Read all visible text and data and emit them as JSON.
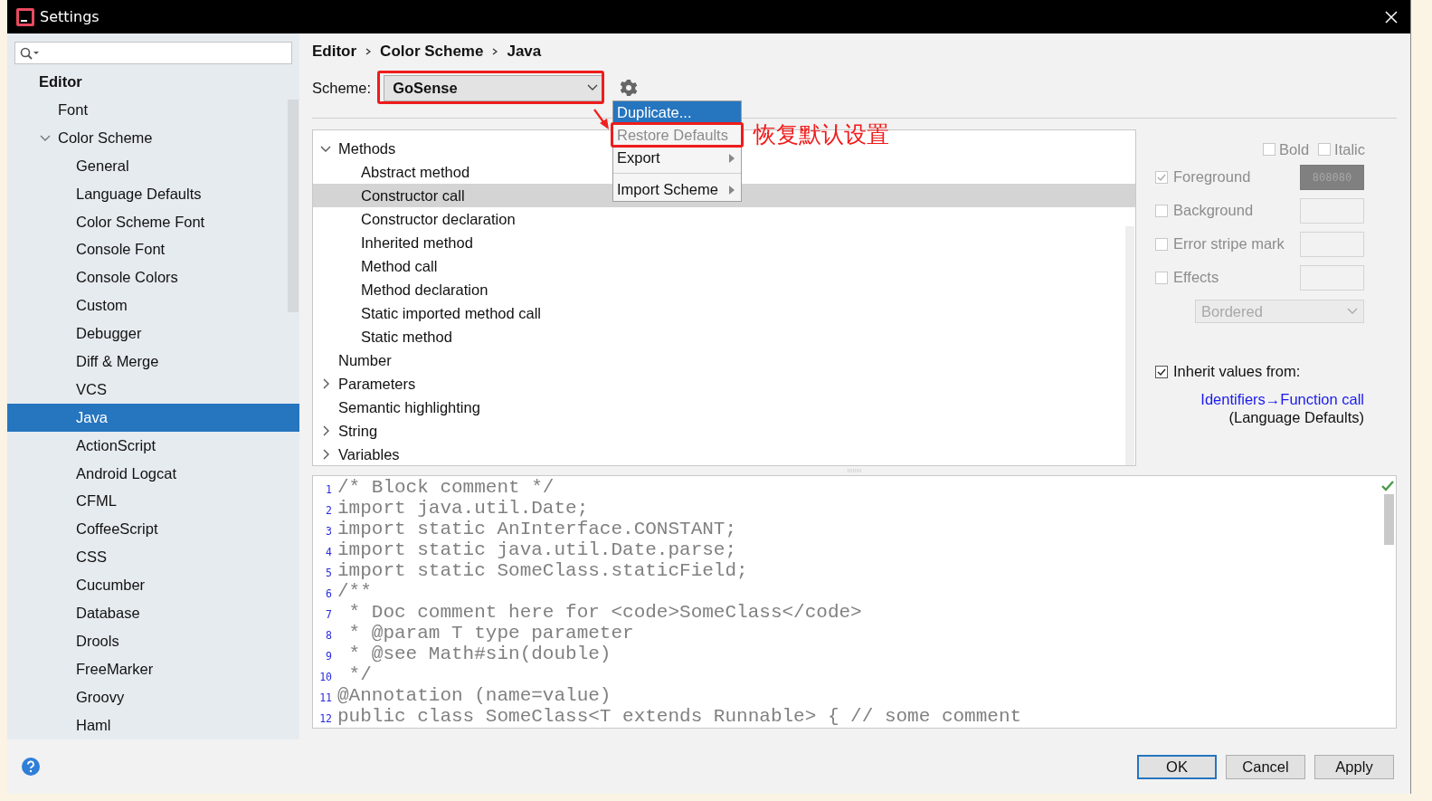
{
  "window": {
    "title": "Settings"
  },
  "sidebar": {
    "section": "Editor",
    "items": [
      {
        "label": "Font",
        "selected": false
      },
      {
        "label": "Color Scheme",
        "selected": false,
        "expanded": true,
        "children": [
          {
            "label": "General",
            "selected": false
          },
          {
            "label": "Language Defaults",
            "selected": false
          },
          {
            "label": "Color Scheme Font",
            "selected": false
          },
          {
            "label": "Console Font",
            "selected": false
          },
          {
            "label": "Console Colors",
            "selected": false
          },
          {
            "label": "Custom",
            "selected": false
          },
          {
            "label": "Debugger",
            "selected": false
          },
          {
            "label": "Diff & Merge",
            "selected": false
          },
          {
            "label": "VCS",
            "selected": false
          },
          {
            "label": "Java",
            "selected": true
          },
          {
            "label": "ActionScript",
            "selected": false
          },
          {
            "label": "Android Logcat",
            "selected": false
          },
          {
            "label": "CFML",
            "selected": false
          },
          {
            "label": "CoffeeScript",
            "selected": false
          },
          {
            "label": "CSS",
            "selected": false
          },
          {
            "label": "Cucumber",
            "selected": false
          },
          {
            "label": "Database",
            "selected": false
          },
          {
            "label": "Drools",
            "selected": false
          },
          {
            "label": "FreeMarker",
            "selected": false
          },
          {
            "label": "Groovy",
            "selected": false
          },
          {
            "label": "Haml",
            "selected": false
          }
        ]
      }
    ]
  },
  "breadcrumb": [
    "Editor",
    "Color Scheme",
    "Java"
  ],
  "scheme": {
    "label": "Scheme:",
    "value": "GoSense"
  },
  "menu": {
    "items": [
      {
        "label": "Duplicate...",
        "selected": true,
        "disabled": false,
        "submenu": false,
        "separator_before": false
      },
      {
        "label": "Restore Defaults",
        "selected": false,
        "disabled": true,
        "submenu": false,
        "separator_before": false
      },
      {
        "label": "Export",
        "selected": false,
        "disabled": false,
        "submenu": true,
        "separator_before": false
      },
      {
        "label": "Import Scheme",
        "selected": false,
        "disabled": false,
        "submenu": true,
        "separator_before": true
      }
    ]
  },
  "annotation": {
    "text": "恢复默认设置"
  },
  "tree": {
    "items": [
      {
        "label": "Methods",
        "selected": false,
        "expanded": true,
        "children": [
          {
            "label": "Abstract method",
            "selected": false
          },
          {
            "label": "Constructor call",
            "selected": true
          },
          {
            "label": "Constructor declaration",
            "selected": false
          },
          {
            "label": "Inherited method",
            "selected": false
          },
          {
            "label": "Method call",
            "selected": false
          },
          {
            "label": "Method declaration",
            "selected": false
          },
          {
            "label": "Static imported method call",
            "selected": false
          },
          {
            "label": "Static method",
            "selected": false
          }
        ]
      },
      {
        "label": "Number",
        "selected": false
      },
      {
        "label": "Parameters",
        "selected": false,
        "expanded": false
      },
      {
        "label": "Semantic highlighting",
        "selected": false
      },
      {
        "label": "String",
        "selected": false,
        "expanded": false
      },
      {
        "label": "Variables",
        "selected": false,
        "expanded": false
      }
    ]
  },
  "attributes": {
    "bold": {
      "label": "Bold",
      "checked": false
    },
    "italic": {
      "label": "Italic",
      "checked": false
    },
    "rows": [
      {
        "label": "Foreground",
        "checked": true,
        "disabled": true,
        "value": "808080"
      },
      {
        "label": "Background",
        "checked": false,
        "disabled": true
      },
      {
        "label": "Error stripe mark",
        "checked": false,
        "disabled": true
      },
      {
        "label": "Effects",
        "checked": false,
        "disabled": true
      }
    ],
    "effect_type": "Bordered",
    "inherit": {
      "label": "Inherit values from:",
      "checked": true
    },
    "inherit_link": "Identifiers→Function call",
    "inherit_source": "(Language Defaults)"
  },
  "preview": {
    "lines": [
      {
        "number": "1",
        "text": "/* Block comment */"
      },
      {
        "number": "2",
        "text": "import java.util.Date;"
      },
      {
        "number": "3",
        "text": "import static AnInterface.CONSTANT;"
      },
      {
        "number": "4",
        "text": "import static java.util.Date.parse;"
      },
      {
        "number": "5",
        "text": "import static SomeClass.staticField;"
      },
      {
        "number": "6",
        "text": "/**"
      },
      {
        "number": "7",
        "text": " * Doc comment here for <code>SomeClass</code>"
      },
      {
        "number": "8",
        "text": " * @param T type parameter"
      },
      {
        "number": "9",
        "text": " * @see Math#sin(double)"
      },
      {
        "number": "10",
        "text": " */"
      },
      {
        "number": "11",
        "text": "@Annotation (name=value)"
      },
      {
        "number": "12",
        "text": "public class SomeClass<T extends Runnable> { // some comment"
      }
    ]
  },
  "buttons": [
    {
      "label": "OK",
      "default": true
    },
    {
      "label": "Cancel",
      "default": false
    },
    {
      "label": "Apply",
      "default": false
    }
  ]
}
